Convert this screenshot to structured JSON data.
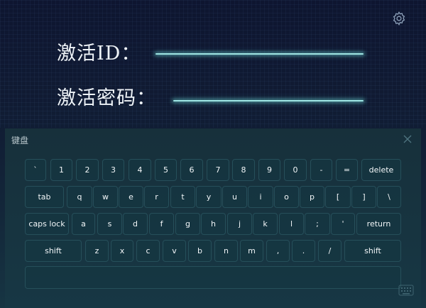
{
  "form": {
    "activation_id_label": "激活ID：",
    "activation_password_label": "激活密码："
  },
  "keyboard": {
    "title": "键盘",
    "rows": [
      [
        "`",
        "1",
        "2",
        "3",
        "4",
        "5",
        "6",
        "7",
        "8",
        "9",
        "0",
        "-",
        "=",
        "delete"
      ],
      [
        "tab",
        "q",
        "w",
        "e",
        "r",
        "t",
        "y",
        "u",
        "i",
        "o",
        "p",
        "[",
        "]",
        "\\"
      ],
      [
        "caps lock",
        "a",
        "s",
        "d",
        "f",
        "g",
        "h",
        "j",
        "k",
        "l",
        ";",
        "'",
        "return"
      ],
      [
        "shift",
        "z",
        "x",
        "c",
        "v",
        "b",
        "n",
        "m",
        ",",
        ".",
        "/",
        "shift"
      ]
    ]
  },
  "icons": {
    "settings": "gear-icon",
    "close": "close-icon",
    "keyboard_toggle": "keyboard-icon"
  },
  "colors": {
    "accent_line": "#9fe6e4",
    "background_top": "#0e1530",
    "keyboard_bg": "#173744"
  }
}
